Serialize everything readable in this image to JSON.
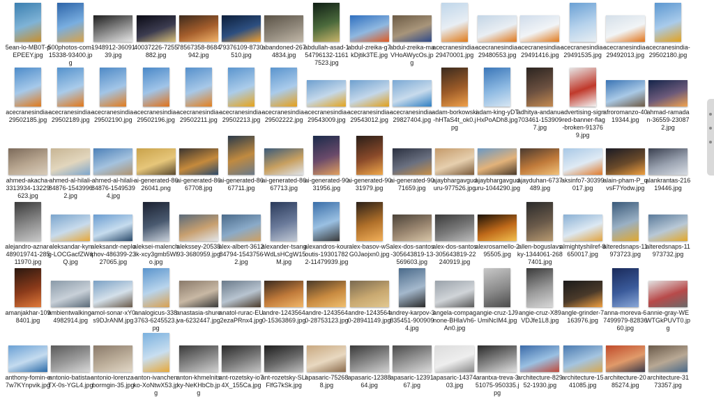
{
  "files": [
    {
      "name": "5ean-lo-MB0T-pEPEEY.jpg",
      "thumb": "tall",
      "colors": [
        "#3b7fb0",
        "#7fb3d6",
        "#c98f2c"
      ]
    },
    {
      "name": "500photos-com-15338-93400.jpg",
      "thumb": "tall",
      "colors": [
        "#2d64a8",
        "#79aee0",
        "#d8a34a"
      ]
    },
    {
      "name": "1948912-3609139.jpg",
      "thumb": "wide",
      "colors": [
        "#1e1e1e",
        "#8c8c8c",
        "#e6e6e6"
      ]
    },
    {
      "name": "40037226-7255882.jpg",
      "thumb": "wide",
      "colors": [
        "#0a0a14",
        "#3c3c50",
        "#d9c07a"
      ]
    },
    {
      "name": "78567358-8684942.jpg",
      "thumb": "wide",
      "colors": [
        "#3d2a1c",
        "#a55e2c",
        "#f2b46b"
      ]
    },
    {
      "name": "79376109-8730510.jpg",
      "thumb": "wide",
      "colors": [
        "#0c1e3a",
        "#2d4f80",
        "#f0a030"
      ]
    },
    {
      "name": "abandoned-2674834.jpg",
      "thumb": "wide",
      "colors": [
        "#5a5246",
        "#8f877a",
        "#c2b8a8"
      ]
    },
    {
      "name": "abdullah-asad-154796132-11617523.jpg",
      "thumb": "tall",
      "colors": [
        "#0f1e14",
        "#4b6a3c",
        "#c8b46a"
      ]
    },
    {
      "name": "abdul-zreika-g7kDjtik3TE.jpg",
      "thumb": "wide",
      "colors": [
        "#2f6fbf",
        "#8fb8e0",
        "#e05a20"
      ]
    },
    {
      "name": "abdul-zreika-maVHoAWycOs.jpg",
      "thumb": "wide",
      "colors": [
        "#6b5a44",
        "#a8957a",
        "#2e4a8a"
      ]
    },
    {
      "name": "acecranesindia-29470001.jpg",
      "thumb": "tall",
      "colors": [
        "#bfd6ea",
        "#e8eef4",
        "#e07b1a"
      ]
    },
    {
      "name": "acecranesindia-29480553.jpg",
      "thumb": "wide",
      "colors": [
        "#c3d5e6",
        "#e9eef3",
        "#e0781c"
      ]
    },
    {
      "name": "acecranesindia-29491416.jpg",
      "thumb": "wide",
      "colors": [
        "#cfdceb",
        "#f1f4f7",
        "#e07a1e"
      ]
    },
    {
      "name": "acecranesindia-29491535.jpg",
      "thumb": "tall",
      "colors": [
        "#6aa0d4",
        "#b6d2ec",
        "#e8eef2"
      ]
    },
    {
      "name": "acecranesindia-29492013.jpg",
      "thumb": "wide",
      "colors": [
        "#d4dfe9",
        "#f1f4f6",
        "#e2741a"
      ]
    },
    {
      "name": "acecranesindia-29502180.jpg",
      "thumb": "tall",
      "colors": [
        "#5c97d0",
        "#a9cbeb",
        "#e4a21e"
      ]
    },
    {
      "name": "acecranesindia-29502185.jpg",
      "thumb": "tall",
      "colors": [
        "#4e8cc9",
        "#a6c9ea",
        "#e07a1c"
      ]
    },
    {
      "name": "acecranesindia-29502189.jpg",
      "thumb": "tall",
      "colors": [
        "#5592cc",
        "#a9cbea",
        "#e2781a"
      ]
    },
    {
      "name": "acecranesindia-29502190.jpg",
      "thumb": "tall",
      "colors": [
        "#4f8ac6",
        "#a2c5e7",
        "#e27c1e"
      ]
    },
    {
      "name": "acecranesindia-29502196.jpg",
      "thumb": "tall",
      "colors": [
        "#4a88c7",
        "#a0c4e8",
        "#e0721a"
      ]
    },
    {
      "name": "acecranesindia-29502211.jpg",
      "thumb": "tall",
      "colors": [
        "#5690cb",
        "#a7c8e8",
        "#e3801f"
      ]
    },
    {
      "name": "acecranesindia-29502213.jpg",
      "thumb": "tall",
      "colors": [
        "#5b95ce",
        "#abccea",
        "#e6a41c"
      ]
    },
    {
      "name": "acecranesindia-29502222.jpg",
      "thumb": "tall",
      "colors": [
        "#5a94cd",
        "#aacbeb",
        "#e5a01c"
      ]
    },
    {
      "name": "acecranesindia-29543009.jpg",
      "thumb": "wide",
      "colors": [
        "#6e9fcf",
        "#c4d8ea",
        "#e3a41e"
      ]
    },
    {
      "name": "acecranesindia-29543012.jpg",
      "thumb": "wide",
      "colors": [
        "#6fa0cf",
        "#c3d7ea",
        "#e0a01c"
      ]
    },
    {
      "name": "acecranesindia-29827404.jpg",
      "thumb": "wide",
      "colors": [
        "#7aa8d4",
        "#c8dbec",
        "#2f7fc2"
      ]
    },
    {
      "name": "adam-borkowski-hHTaS4t_ok0.jpg",
      "thumb": "tall",
      "colors": [
        "#3a2a1e",
        "#9c5b28",
        "#f0a14a"
      ]
    },
    {
      "name": "adam-king-yDTHxPoADh8.jpg",
      "thumb": "tall",
      "colors": [
        "#3a76b8",
        "#8db9e2",
        "#d7e6f3"
      ]
    },
    {
      "name": "adhitya-andanu-703461-1539097.jpg",
      "thumb": "tall",
      "colors": [
        "#2b2420",
        "#6b5040",
        "#c48a50"
      ]
    },
    {
      "name": "advertising-sign-red-banner-flag-broken-913769.jpg",
      "thumb": "tall",
      "colors": [
        "#e6e6e6",
        "#c0392b",
        "#f4f4f4"
      ]
    },
    {
      "name": "afroromanzo-4019344.jpg",
      "thumb": "wide",
      "colors": [
        "#3a74b4",
        "#a9c9e6",
        "#6e5a44"
      ]
    },
    {
      "name": "ahmad-ramadan-36559-230872.jpg",
      "thumb": "wide",
      "colors": [
        "#14244a",
        "#6c5a7a",
        "#f2a450"
      ]
    },
    {
      "name": "ahmed-akacha-3313934-13229623.jpg",
      "thumb": "wide",
      "colors": [
        "#7c6a5a",
        "#b8a690",
        "#d9cdbb"
      ]
    },
    {
      "name": "ahmed-al-hilali-84876-1543996 2.jpg",
      "thumb": "wide",
      "colors": [
        "#c7b594",
        "#e2d6bd",
        "#7da6cd"
      ]
    },
    {
      "name": "ahmed-al-hilali-84876-1549539 4.jpg",
      "thumb": "wide",
      "colors": [
        "#4c80b8",
        "#a4c2de",
        "#b09470"
      ]
    },
    {
      "name": "ai-generated-8626041.png",
      "thumb": "wide",
      "colors": [
        "#c9a24a",
        "#e6c67a",
        "#5a4a30"
      ]
    },
    {
      "name": "ai-generated-8667708.jpg",
      "thumb": "wide",
      "colors": [
        "#3b3530",
        "#c58a3c",
        "#2c4a6a"
      ]
    },
    {
      "name": "ai-generated-8667711.jpg",
      "thumb": "tall",
      "colors": [
        "#2a3a4a",
        "#c08a40",
        "#6a7a8a"
      ]
    },
    {
      "name": "ai-generated-8667713.jpg",
      "thumb": "wide",
      "colors": [
        "#3a5a7a",
        "#c8a060",
        "#dfe4ea"
      ]
    },
    {
      "name": "ai-generated-9031956.jpg",
      "thumb": "tall",
      "colors": [
        "#1a2a4a",
        "#6a4a6a",
        "#e2a060"
      ]
    },
    {
      "name": "ai-generated-9031979.jpg",
      "thumb": "tall",
      "colors": [
        "#2a1e18",
        "#8a4a2a",
        "#f0a84a"
      ]
    },
    {
      "name": "ai-generated-9071659.jpg",
      "thumb": "wide",
      "colors": [
        "#2a3040",
        "#6a7080",
        "#c89048"
      ]
    },
    {
      "name": "ajaybhargavguduru-977526.jpg",
      "thumb": "wide",
      "colors": [
        "#c49a6a",
        "#e6cfae",
        "#7a5a3a"
      ]
    },
    {
      "name": "ajaybhargavguduru-1044290.jpg",
      "thumb": "wide",
      "colors": [
        "#6a98c4",
        "#e2b27a",
        "#4a3a2a"
      ]
    },
    {
      "name": "ajayduhan-6737489.jpg",
      "thumb": "wide",
      "colors": [
        "#4a3a30",
        "#c07a3a",
        "#f2c27a"
      ]
    },
    {
      "name": "aksinfo7-30399017.jpg",
      "thumb": "wide",
      "colors": [
        "#a8c8e6",
        "#dfeaf4",
        "#e07a2a"
      ]
    },
    {
      "name": "alain-pham-P_qvsF7Yodw.jpg",
      "thumb": "wide",
      "colors": [
        "#1a1a24",
        "#6a4a2a",
        "#f0a040"
      ]
    },
    {
      "name": "alankrantas-21619446.jpg",
      "thumb": "wide",
      "colors": [
        "#3a4050",
        "#9aa2b0",
        "#d8dde4"
      ]
    },
    {
      "name": "alejandro-aznar-489019741-28511970.jpg",
      "thumb": "tall",
      "colors": [
        "#3a3a3a",
        "#8a8a8a",
        "#c8c8c8"
      ]
    },
    {
      "name": "aleksandar-kyng-LOCGacfZWqQ.jpg",
      "thumb": "wide",
      "colors": [
        "#7aa4cc",
        "#c8dbec",
        "#e6a83a"
      ]
    },
    {
      "name": "aleksandr-neplokhov-486399-2327065.jpg",
      "thumb": "wide",
      "colors": [
        "#6a9cd0",
        "#c6dcee",
        "#2a4a6a"
      ]
    },
    {
      "name": "aleksei-malenchik-xcy3gmb5Wlo.jpg",
      "thumb": "tall",
      "colors": [
        "#1a2030",
        "#4a5a70",
        "#c8d0da"
      ]
    },
    {
      "name": "alekssey-2053893-3680959.jpg",
      "thumb": "wide",
      "colors": [
        "#5a6a7a",
        "#c8a070",
        "#e2e6ea"
      ]
    },
    {
      "name": "alex-albert-361284794-15437562.jpg",
      "thumb": "wide",
      "colors": [
        "#4a6a8a",
        "#8aaac8",
        "#d0a060"
      ]
    },
    {
      "name": "alexander-tsang-WdLsHCgW15M.jpg",
      "thumb": "tall",
      "colors": [
        "#2a3a5a",
        "#6a7a9a",
        "#c0c8d4"
      ]
    },
    {
      "name": "alexandros-kouroutis-193017822-11479939.jpg",
      "thumb": "tall",
      "colors": [
        "#3a6ea8",
        "#9ac0e2",
        "#3a3a3a"
      ]
    },
    {
      "name": "alex-basov-wSG0Jaojxn0.jpg",
      "thumb": "tall",
      "colors": [
        "#2a2018",
        "#b0702a",
        "#f2b05a"
      ]
    },
    {
      "name": "alex-dos-santos-305643819-13569603.jpg",
      "thumb": "wide",
      "colors": [
        "#4a4238",
        "#9a8670",
        "#d8c6a8"
      ]
    },
    {
      "name": "alex-dos-santos-305643819-22240919.jpg",
      "thumb": "wide",
      "colors": [
        "#3a3a3a",
        "#7a7a7a",
        "#bcbcbc"
      ]
    },
    {
      "name": "alexrosamello-295505.jpg",
      "thumb": "wide",
      "colors": [
        "#1a1208",
        "#c06a1a",
        "#f2c050"
      ]
    },
    {
      "name": "allen-boguslavsky-1344061-2687401.jpg",
      "thumb": "tall",
      "colors": [
        "#2a2a2a",
        "#6a5a4a",
        "#b89a70"
      ]
    },
    {
      "name": "almightyshilref-8650017.jpg",
      "thumb": "wide",
      "colors": [
        "#8ab0d4",
        "#dce8f2",
        "#e2a440"
      ]
    },
    {
      "name": "alteredsnaps-11973723.jpg",
      "thumb": "tall",
      "colors": [
        "#3a5a7a",
        "#9ab0c4",
        "#e0a830"
      ]
    },
    {
      "name": "alteredsnaps-11973732.jpg",
      "thumb": "wide",
      "colors": [
        "#5a7a9a",
        "#b8c8d6",
        "#e4a828"
      ]
    },
    {
      "name": "amanjakhar-1098401.jpg",
      "thumb": "tall",
      "colors": [
        "#2a1810",
        "#8a3a1a",
        "#e07a3a"
      ]
    },
    {
      "name": "ambientwalking-4982914.jpg",
      "thumb": "wide",
      "colors": [
        "#8a9aa8",
        "#c8d0d8",
        "#5a6a78"
      ]
    },
    {
      "name": "amol-sonar-xY0s9DJrANM.jpg",
      "thumb": "wide",
      "colors": [
        "#7aa0c4",
        "#d4e0ea",
        "#6a5a4a"
      ]
    },
    {
      "name": "analogicus-3383763-6245523.jpg",
      "thumb": "tall",
      "colors": [
        "#5a94cc",
        "#b8d4ec",
        "#d8a050"
      ]
    },
    {
      "name": "anastasia-shureva-6232447.jpg",
      "thumb": "wide",
      "colors": [
        "#8a7a6a",
        "#c8b8a4",
        "#3a3a3a"
      ]
    },
    {
      "name": "anatol-rurac-EU2ezaPRnx4.jpg",
      "thumb": "wide",
      "colors": [
        "#6a7a8a",
        "#b8c4d0",
        "#4a3a2a"
      ]
    },
    {
      "name": "andre-1243564 0-15363869.jpg",
      "thumb": "wide",
      "colors": [
        "#3a2a1e",
        "#c07a3a",
        "#f2b86a"
      ]
    },
    {
      "name": "andre-1243564 0-28753123.jpg",
      "thumb": "wide",
      "colors": [
        "#4a3a28",
        "#c88a40",
        "#f0c070"
      ]
    },
    {
      "name": "andre-1243564 0-28941149.jpg",
      "thumb": "wide",
      "colors": [
        "#7a6a50",
        "#c8a870",
        "#e2c890"
      ]
    },
    {
      "name": "andrey-karpov-3835451-9009094.jpg",
      "thumb": "tall",
      "colors": [
        "#4a6a8a",
        "#a4b8cc",
        "#2a2a2a"
      ]
    },
    {
      "name": "angela-compagnone-BHlaVh6-An0.jpg",
      "thumb": "wide",
      "colors": [
        "#9aa2aa",
        "#d0d4d8",
        "#5a5a5a"
      ]
    },
    {
      "name": "angie-cruz-1J9UmiNcIM4.jpg",
      "thumb": "tall",
      "colors": [
        "#c8c8c8",
        "#8a8a8a",
        "#4a4a4a"
      ]
    },
    {
      "name": "angie-cruz-X89VDJfe1L8.jpg",
      "thumb": "tall",
      "colors": [
        "#3a3a3a",
        "#9a9a9a",
        "#d8d8d8"
      ]
    },
    {
      "name": "angle-grinder-7163976.jpg",
      "thumb": "wide",
      "colors": [
        "#1a1a1a",
        "#4a3a2a",
        "#f0a040"
      ]
    },
    {
      "name": "anna-moreva-67499979-8283660.jpg",
      "thumb": "tall",
      "colors": [
        "#1a2a5a",
        "#3a5a9a",
        "#8aa8d8"
      ]
    },
    {
      "name": "annie-gray-WEWTGkPUVT0.jpg",
      "thumb": "wide",
      "colors": [
        "#e2e2e2",
        "#b84a4a",
        "#6a6a6a"
      ]
    },
    {
      "name": "anthony-fomin-e7w7KYnpvik.jpg",
      "thumb": "wide",
      "colors": [
        "#6aa0d4",
        "#c4dbef",
        "#2a6aa8"
      ]
    },
    {
      "name": "antonio-batista-TX-0s-YGL4.jpg",
      "thumb": "wide",
      "colors": [
        "#5a5a5a",
        "#9a9a9a",
        "#d8d8d8"
      ]
    },
    {
      "name": "antonio-lorenza-bormgin-35.jpg",
      "thumb": "wide",
      "colors": [
        "#8a7a6a",
        "#bcae9a",
        "#e2d8c8"
      ]
    },
    {
      "name": "anton-ivanchenko-XoNtwX53.jpg",
      "thumb": "tall",
      "colors": [
        "#7ab0de",
        "#c8def0",
        "#e6a83a"
      ]
    },
    {
      "name": "anton-khmelnitsky-NeKHbCb.jpg",
      "thumb": "wide",
      "colors": [
        "#3a3a3a",
        "#8a8a8a",
        "#d0d0d0"
      ]
    },
    {
      "name": "ant-rozetsky-io74X_155Ca.jpg",
      "thumb": "wide",
      "colors": [
        "#2a2a2a",
        "#7a7a7a",
        "#c4c4c4"
      ]
    },
    {
      "name": "ant-rozetsky-SLlFlfG7kSk.jpg",
      "thumb": "wide",
      "colors": [
        "#1e1e1e",
        "#6a6a6a",
        "#bcbcbc"
      ]
    },
    {
      "name": "apasaric-75268 8.jpg",
      "thumb": "wide",
      "colors": [
        "#c8a880",
        "#e8d8c0",
        "#8a6a4a"
      ]
    },
    {
      "name": "apasaric-12388 64.jpg",
      "thumb": "wide",
      "colors": [
        "#3a3a3a",
        "#8a8a8a",
        "#d0d0d0"
      ]
    },
    {
      "name": "apasaric-12391 67.jpg",
      "thumb": "wide",
      "colors": [
        "#4a4a4a",
        "#9a9a9a",
        "#dadada"
      ]
    },
    {
      "name": "apasaric-14374 03.jpg",
      "thumb": "wide",
      "colors": [
        "#dcdcdc",
        "#eeeeee",
        "#8a8a8a"
      ]
    },
    {
      "name": "arantxa-treva-351075-950335.jpg",
      "thumb": "wide",
      "colors": [
        "#2a2a2a",
        "#8a8a8a",
        "#e0e0e0"
      ]
    },
    {
      "name": "architecture-82952-1930.jpg",
      "thumb": "wide",
      "colors": [
        "#3a6aa8",
        "#9ac0e2",
        "#c04a3a"
      ]
    },
    {
      "name": "architecture-15 41085.jpg",
      "thumb": "wide",
      "colors": [
        "#4a7ab0",
        "#a4c4e0",
        "#d8a850"
      ]
    },
    {
      "name": "architecture-20 85274.jpg",
      "thumb": "wide",
      "colors": [
        "#c04a2a",
        "#e09a6a",
        "#3a3a4a"
      ]
    },
    {
      "name": "architecture-31 73357.jpg",
      "thumb": "wide",
      "colors": [
        "#6a5a4a",
        "#b8a894",
        "#4a6a8a"
      ]
    }
  ]
}
